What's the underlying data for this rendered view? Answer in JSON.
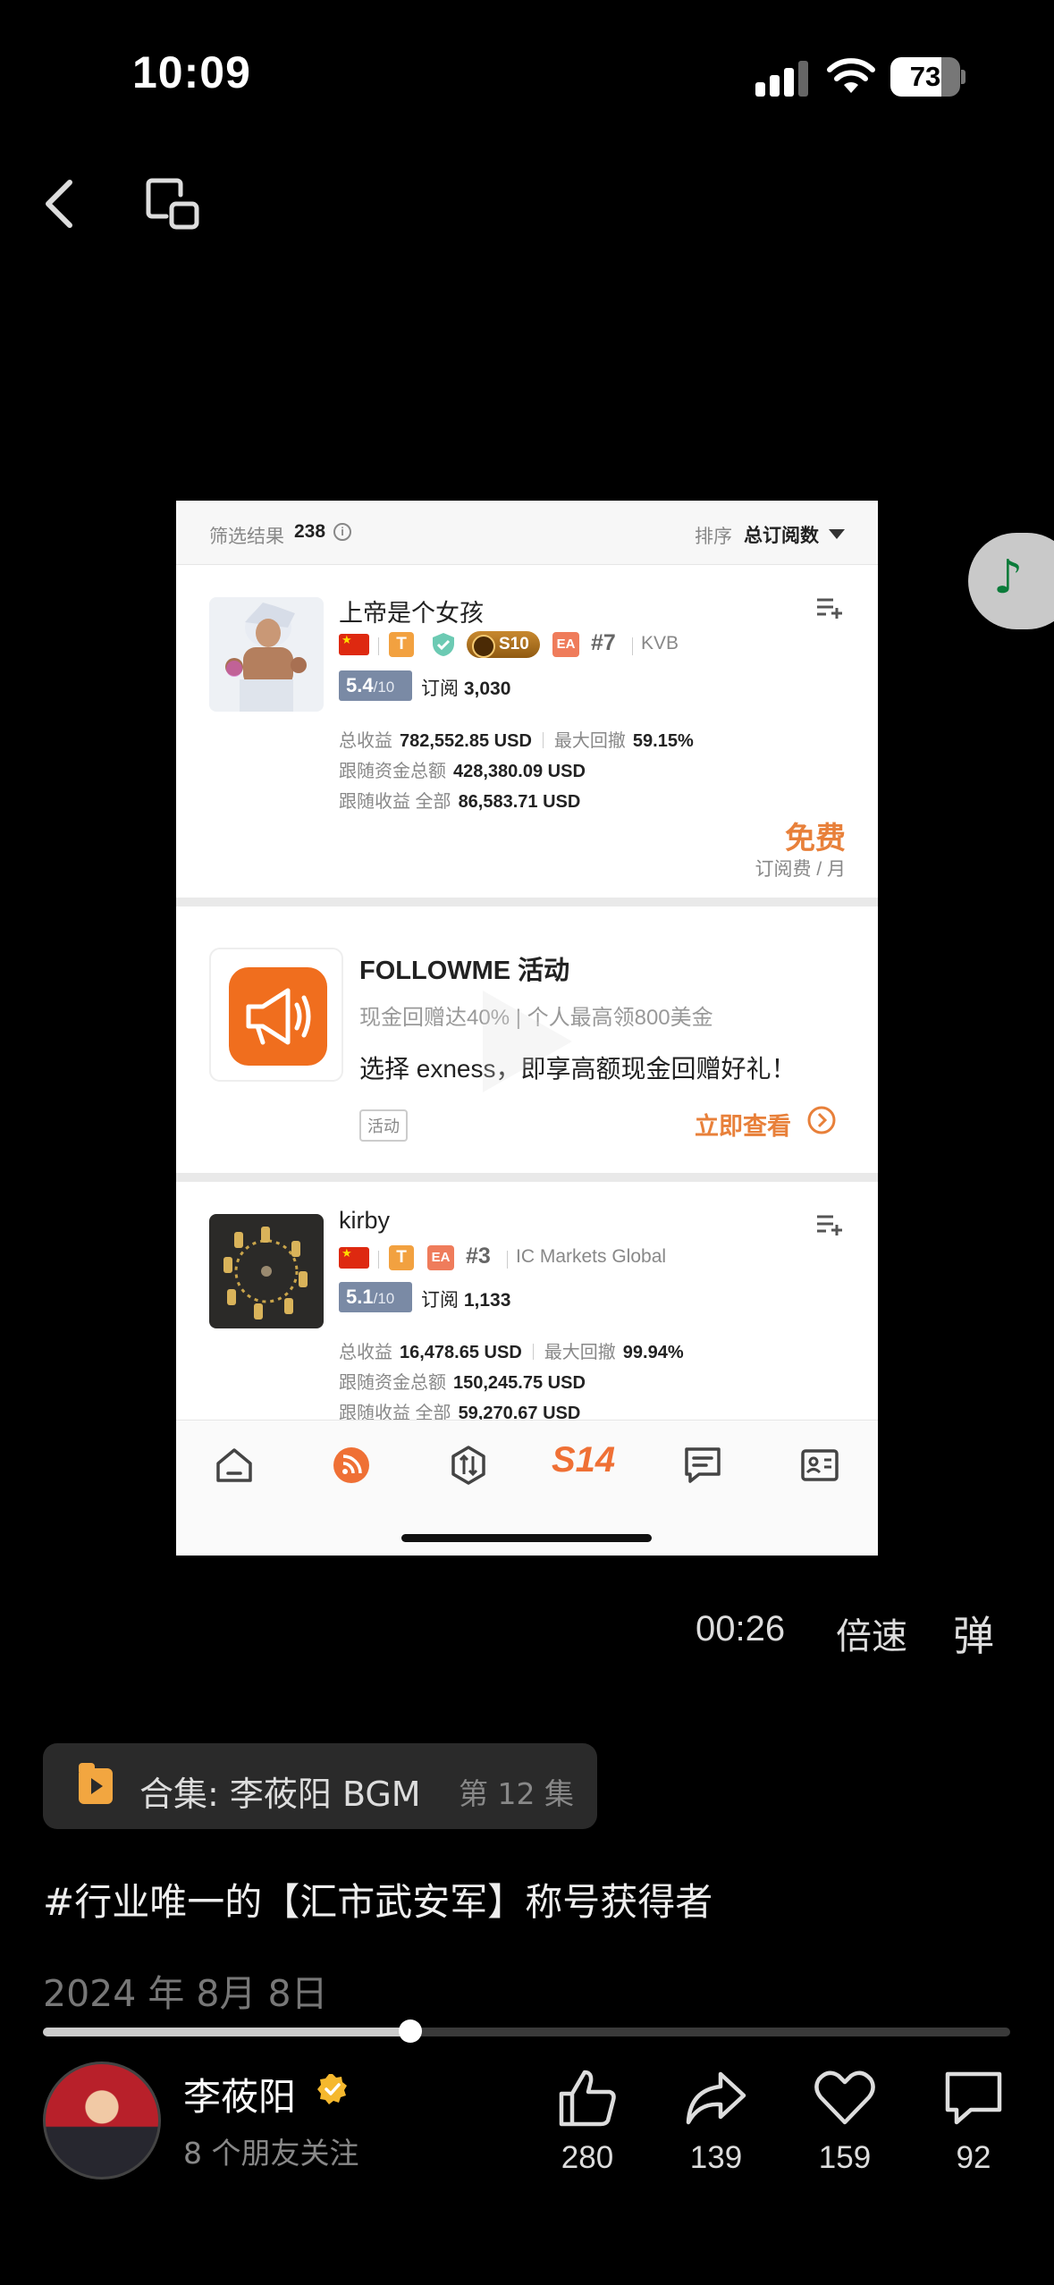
{
  "status_bar": {
    "time": "10:09",
    "battery": "73",
    "battery_level": 0.73
  },
  "video_frame": {
    "filter": {
      "label": "筛选结果",
      "count": "238",
      "sort_label": "排序",
      "sort_value": "总订阅数"
    },
    "trader1": {
      "name": "上帝是个女孩",
      "badge_s": "S10",
      "badge_t": "T",
      "badge_ea": "EA",
      "rank": "#7",
      "broker": "KVB",
      "score": "5.4",
      "score_max": "/10",
      "sub_label": "订阅",
      "sub_count": "3,030",
      "stat_total_label": "总收益",
      "stat_total": "782,552.85 USD",
      "stat_dd_label": "最大回撤",
      "stat_dd": "59.15%",
      "stat_funds_label": "跟随资金总额",
      "stat_funds": "428,380.09 USD",
      "stat_follow_label": "跟随收益 全部",
      "stat_follow": "86,583.71 USD",
      "price": "免费",
      "price_unit": "订阅费 / 月"
    },
    "ad": {
      "title": "FOLLOWME 活动",
      "subtitle": "现金回赠达40% | 个人最高领800美金",
      "desc": "选择 exness，即享高额现金回赠好礼！",
      "tag": "活动",
      "link": "立即查看"
    },
    "trader2": {
      "name": "kirby",
      "badge_t": "T",
      "badge_ea": "EA",
      "rank": "#3",
      "broker": "IC Markets Global",
      "score": "5.1",
      "score_max": "/10",
      "sub_label": "订阅",
      "sub_count": "1,133",
      "stat_total_label": "总收益",
      "stat_total": "16,478.65 USD",
      "stat_dd_label": "最大回撤",
      "stat_dd": "99.94%",
      "stat_funds_label": "跟随资金总额",
      "stat_funds": "150,245.75 USD",
      "stat_follow_label": "跟随收益 全部",
      "stat_follow": "59,270.67 USD"
    },
    "tabbar": {
      "s14": "S14"
    }
  },
  "player": {
    "time": "00:26",
    "speed": "倍速",
    "danmaku": "弹",
    "collection_title": "合集: 李莜阳 BGM",
    "collection_episode": "第 12 集",
    "caption": "#行业唯一的【汇市武安军】称号获得者",
    "date": "2024 年 8月 8日",
    "progress": 0.38
  },
  "author": {
    "name": "李莜阳",
    "friends": "8 个朋友关注"
  },
  "actions": {
    "like": "280",
    "share": "139",
    "favorite": "159",
    "comment": "92"
  },
  "colors": {
    "accent_orange": "#e8803a",
    "verified_gold": "#f5b82e",
    "music_green": "#0b7b3a"
  }
}
